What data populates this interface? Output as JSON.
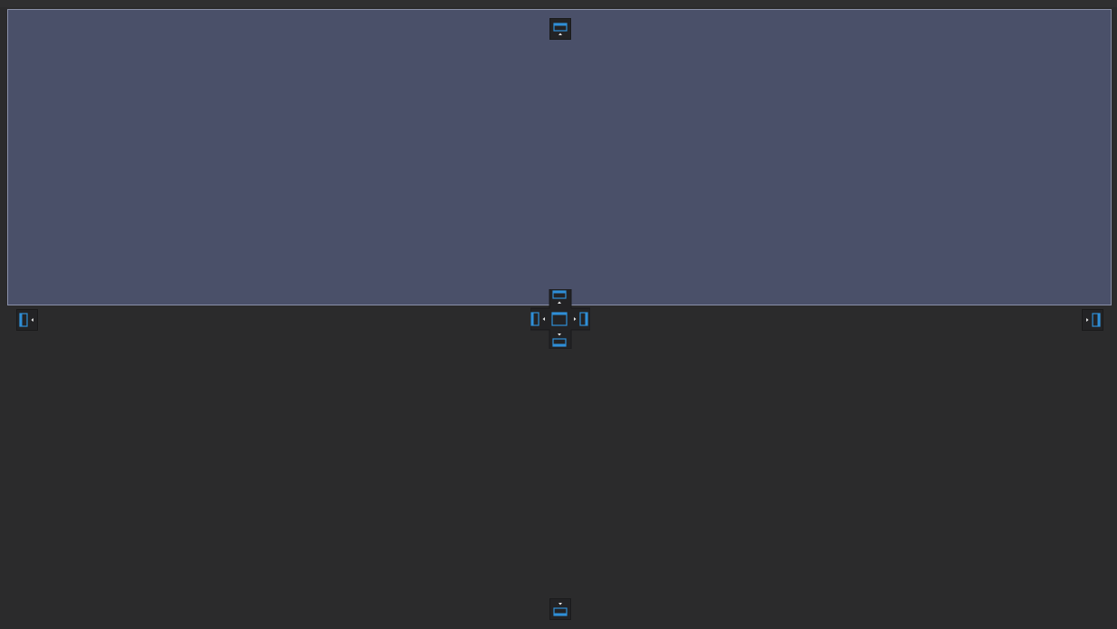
{
  "colors": {
    "background": "#2b2b2c",
    "drop_preview_fill": "#4a5069",
    "drop_preview_border": "#8a90a8",
    "dock_icon_accent": "#2f8fd8",
    "dock_button_bg": "#232325"
  },
  "dock_targets": [
    {
      "name": "dock-top-outer",
      "icon": "dock-top-icon"
    },
    {
      "name": "dock-center-top",
      "icon": "dock-top-icon"
    },
    {
      "name": "dock-center-left",
      "icon": "dock-left-icon"
    },
    {
      "name": "dock-center-fill",
      "icon": "dock-fill-icon"
    },
    {
      "name": "dock-center-right",
      "icon": "dock-right-icon"
    },
    {
      "name": "dock-center-bottom",
      "icon": "dock-bottom-icon"
    },
    {
      "name": "dock-left-outer",
      "icon": "dock-left-icon"
    },
    {
      "name": "dock-right-outer",
      "icon": "dock-right-icon"
    },
    {
      "name": "dock-bottom-outer",
      "icon": "dock-bottom-icon"
    }
  ]
}
